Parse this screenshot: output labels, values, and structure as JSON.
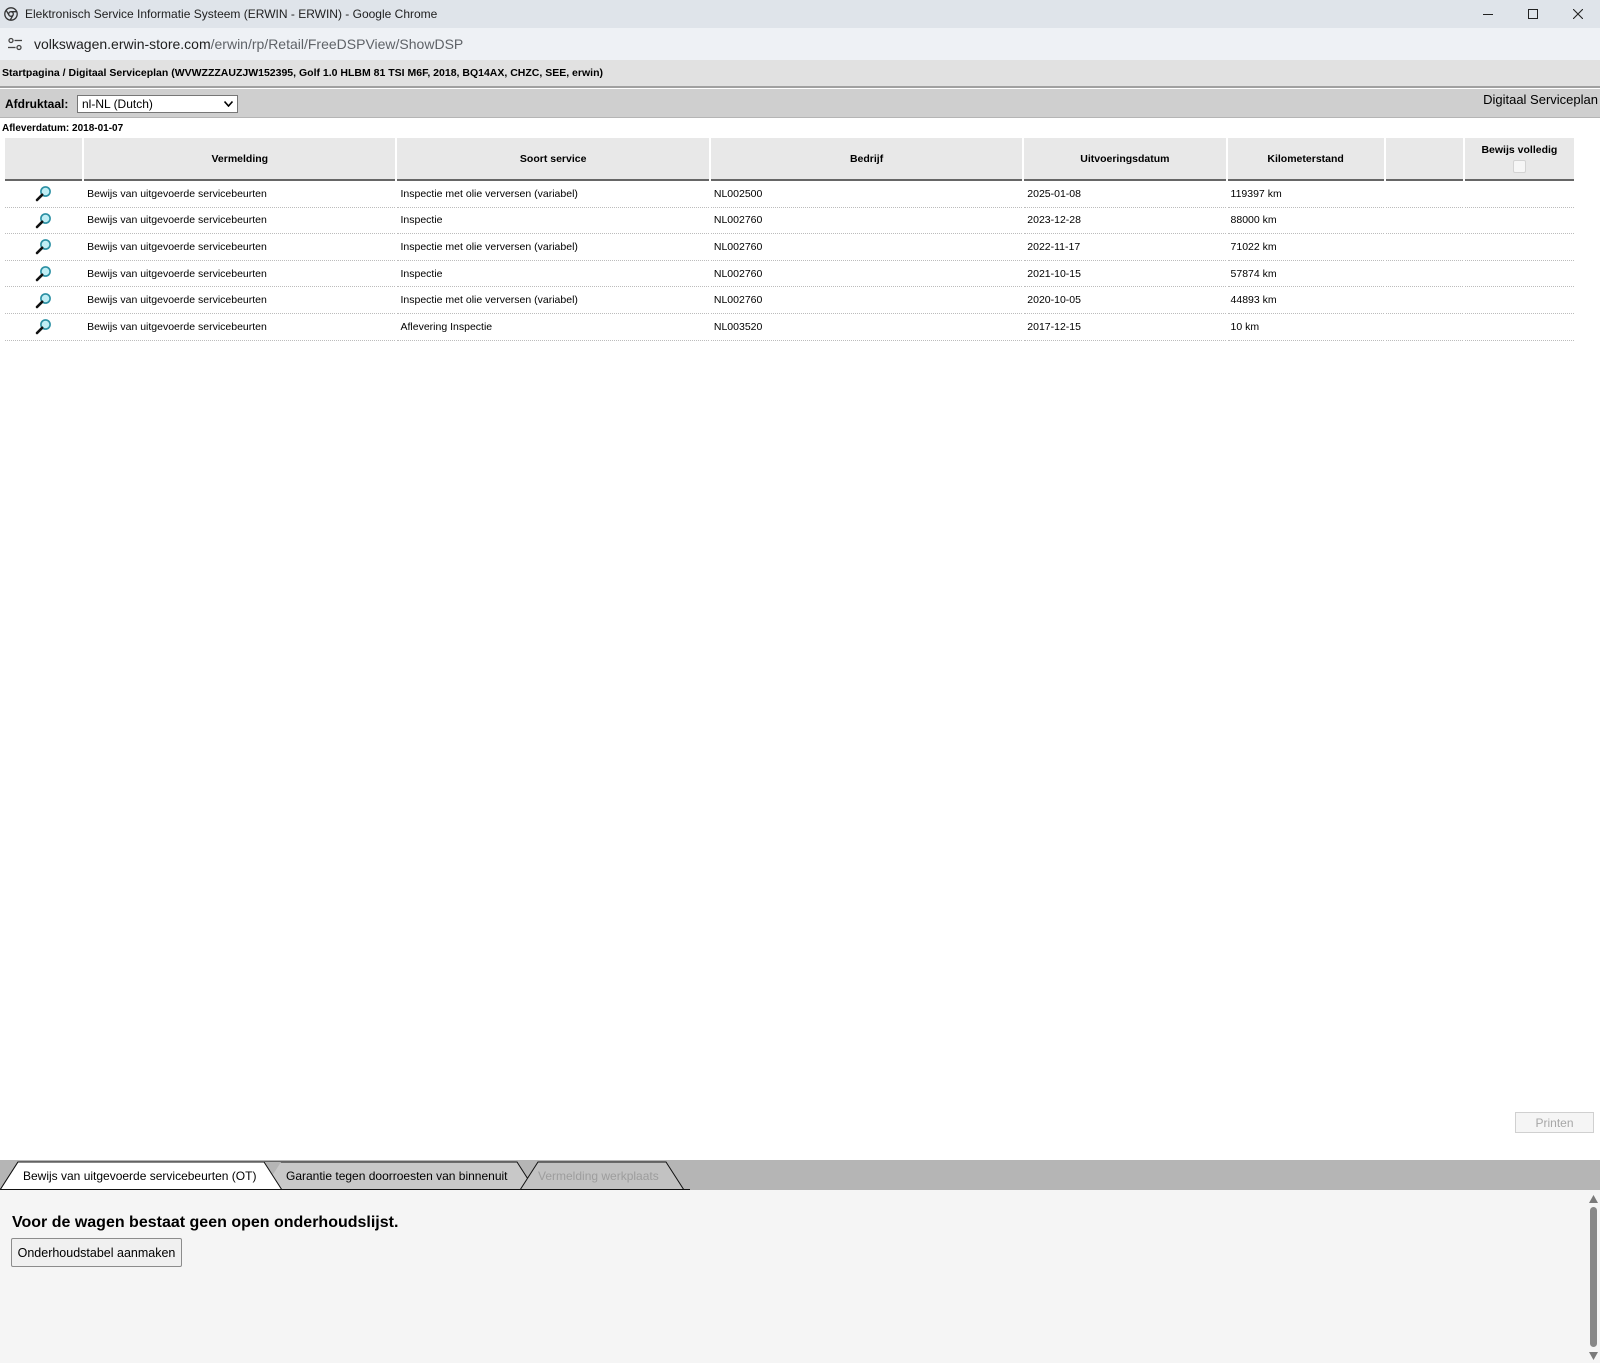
{
  "window": {
    "title": "Elektronisch Service Informatie Systeem (ERWIN - ERWIN) - Google Chrome"
  },
  "address_bar": {
    "host": "volkswagen.erwin-store.com",
    "path": "/erwin/rp/Retail/FreeDSPView/ShowDSP"
  },
  "breadcrumb": "Startpagina / Digitaal Serviceplan (WVWZZZAUZJW152395, Golf 1.0 HLBM 81 TSI M6F, 2018, BQ14AX, CHZC, SEE, erwin)",
  "toolbar": {
    "print_language_label": "Afdruktaal:",
    "print_language_value": "nl-NL (Dutch)",
    "heading": "Digitaal Serviceplan"
  },
  "delivery_date": "Afleverdatum: 2018-01-07",
  "table": {
    "headers": {
      "entry": "Vermelding",
      "service_type": "Soort service",
      "company": "Bedrijf",
      "date": "Uitvoeringsdatum",
      "mileage": "Kilometerstand",
      "blank": "",
      "proof_complete": "Bewijs volledig"
    },
    "rows": [
      {
        "entry": "Bewijs van uitgevoerde servicebeurten",
        "service_type": "Inspectie met olie verversen (variabel)",
        "company": "NL002500",
        "date": "2025-01-08",
        "mileage": "119397 km"
      },
      {
        "entry": "Bewijs van uitgevoerde servicebeurten",
        "service_type": "Inspectie",
        "company": "NL002760",
        "date": "2023-12-28",
        "mileage": "88000 km"
      },
      {
        "entry": "Bewijs van uitgevoerde servicebeurten",
        "service_type": "Inspectie met olie verversen (variabel)",
        "company": "NL002760",
        "date": "2022-11-17",
        "mileage": "71022 km"
      },
      {
        "entry": "Bewijs van uitgevoerde servicebeurten",
        "service_type": "Inspectie",
        "company": "NL002760",
        "date": "2021-10-15",
        "mileage": "57874 km"
      },
      {
        "entry": "Bewijs van uitgevoerde servicebeurten",
        "service_type": "Inspectie met olie verversen (variabel)",
        "company": "NL002760",
        "date": "2020-10-05",
        "mileage": "44893 km"
      },
      {
        "entry": "Bewijs van uitgevoerde servicebeurten",
        "service_type": "Aflevering Inspectie",
        "company": "NL003520",
        "date": "2017-12-15",
        "mileage": "10 km"
      }
    ],
    "row_icon": "magnifier-icon"
  },
  "print_button": "Printen",
  "tabs": [
    {
      "label": "Bewijs van uitgevoerde servicebeurten (OT)",
      "state": "active"
    },
    {
      "label": "Garantie tegen doorroesten van binnenuit",
      "state": "normal"
    },
    {
      "label": "Vermelding werkplaats",
      "state": "disabled"
    }
  ],
  "bottom_pane": {
    "message": "Voor de wagen bestaat geen open onderhoudslijst.",
    "create_button": "Onderhoudstabel aanmaken"
  },
  "colors": {
    "titlebar_bg": "#dfe4ea",
    "header_bg": "#e8e8e8",
    "toolbar_bg": "#cfcfcf",
    "tabstrip_bg": "#b5b5b5",
    "magnifier_lens": "#3aa6b9"
  }
}
